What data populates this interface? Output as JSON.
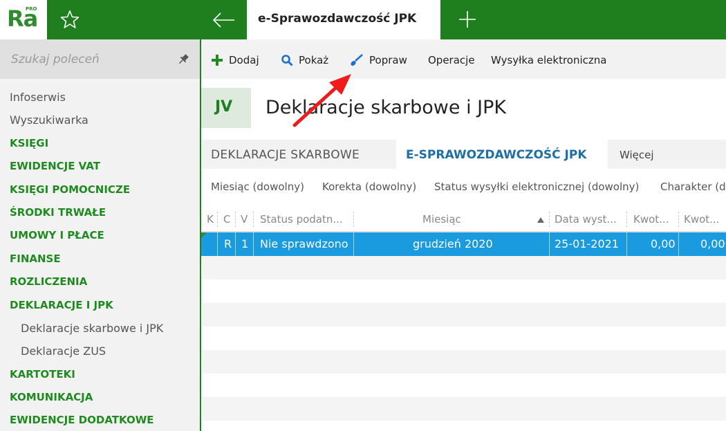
{
  "app": {
    "logo_text": "Ra",
    "logo_badge": "PRO",
    "active_tab": "e-Sprawozdawczość JPK",
    "brand_color": "#1f7f1f",
    "selection_color": "#1a9be0"
  },
  "sidebar": {
    "search_placeholder": "Szukaj poleceń",
    "items": [
      {
        "label": "Infoserwis",
        "kind": "plain"
      },
      {
        "label": "Wyszukiwarka",
        "kind": "plain"
      },
      {
        "label": "KSIĘGI",
        "kind": "section"
      },
      {
        "label": "EWIDENCJE VAT",
        "kind": "section"
      },
      {
        "label": "KSIĘGI POMOCNICZE",
        "kind": "section"
      },
      {
        "label": "ŚRODKI TRWAŁE",
        "kind": "section"
      },
      {
        "label": "UMOWY I PŁACE",
        "kind": "section"
      },
      {
        "label": "FINANSE",
        "kind": "section"
      },
      {
        "label": "ROZLICZENIA",
        "kind": "section"
      },
      {
        "label": "DEKLARACJE I JPK",
        "kind": "section"
      },
      {
        "label": "Deklaracje skarbowe i JPK",
        "kind": "sub"
      },
      {
        "label": "Deklaracje ZUS",
        "kind": "sub"
      },
      {
        "label": "KARTOTEKI",
        "kind": "section"
      },
      {
        "label": "KOMUNIKACJA",
        "kind": "section"
      },
      {
        "label": "EWIDENCJE DODATKOWE",
        "kind": "section"
      }
    ]
  },
  "toolbar": {
    "add_label": "Dodaj",
    "show_label": "Pokaż",
    "edit_label": "Popraw",
    "operations_label": "Operacje",
    "send_label": "Wysyłka elektroniczna"
  },
  "page": {
    "badge": "JV",
    "title": "Deklaracje skarbowe i JPK"
  },
  "subtabs": {
    "tab1": "DEKLARACJE SKARBOWE",
    "tab2": "E-SPRAWOZDAWCZOŚĆ JPK",
    "more": "Więcej"
  },
  "filters": {
    "month": "Miesiąc (dowolny)",
    "correction": "Korekta (dowolny)",
    "status": "Status wysyłki elektronicznej (dowolny)",
    "character": "Charakter (d"
  },
  "grid": {
    "columns": {
      "k": "K",
      "c": "C",
      "v": "V",
      "status": "Status podatn...",
      "month": "Miesiąc",
      "date": "Data wyst...",
      "amount1": "Kwot...",
      "amount2": "Kwot..."
    },
    "row": {
      "k": "",
      "c": "R",
      "v": "1",
      "status": "Nie sprawdzono",
      "month": "grudzień 2020",
      "date": "25-01-2021",
      "amount1": "0,00",
      "amount2": "0,00"
    }
  }
}
